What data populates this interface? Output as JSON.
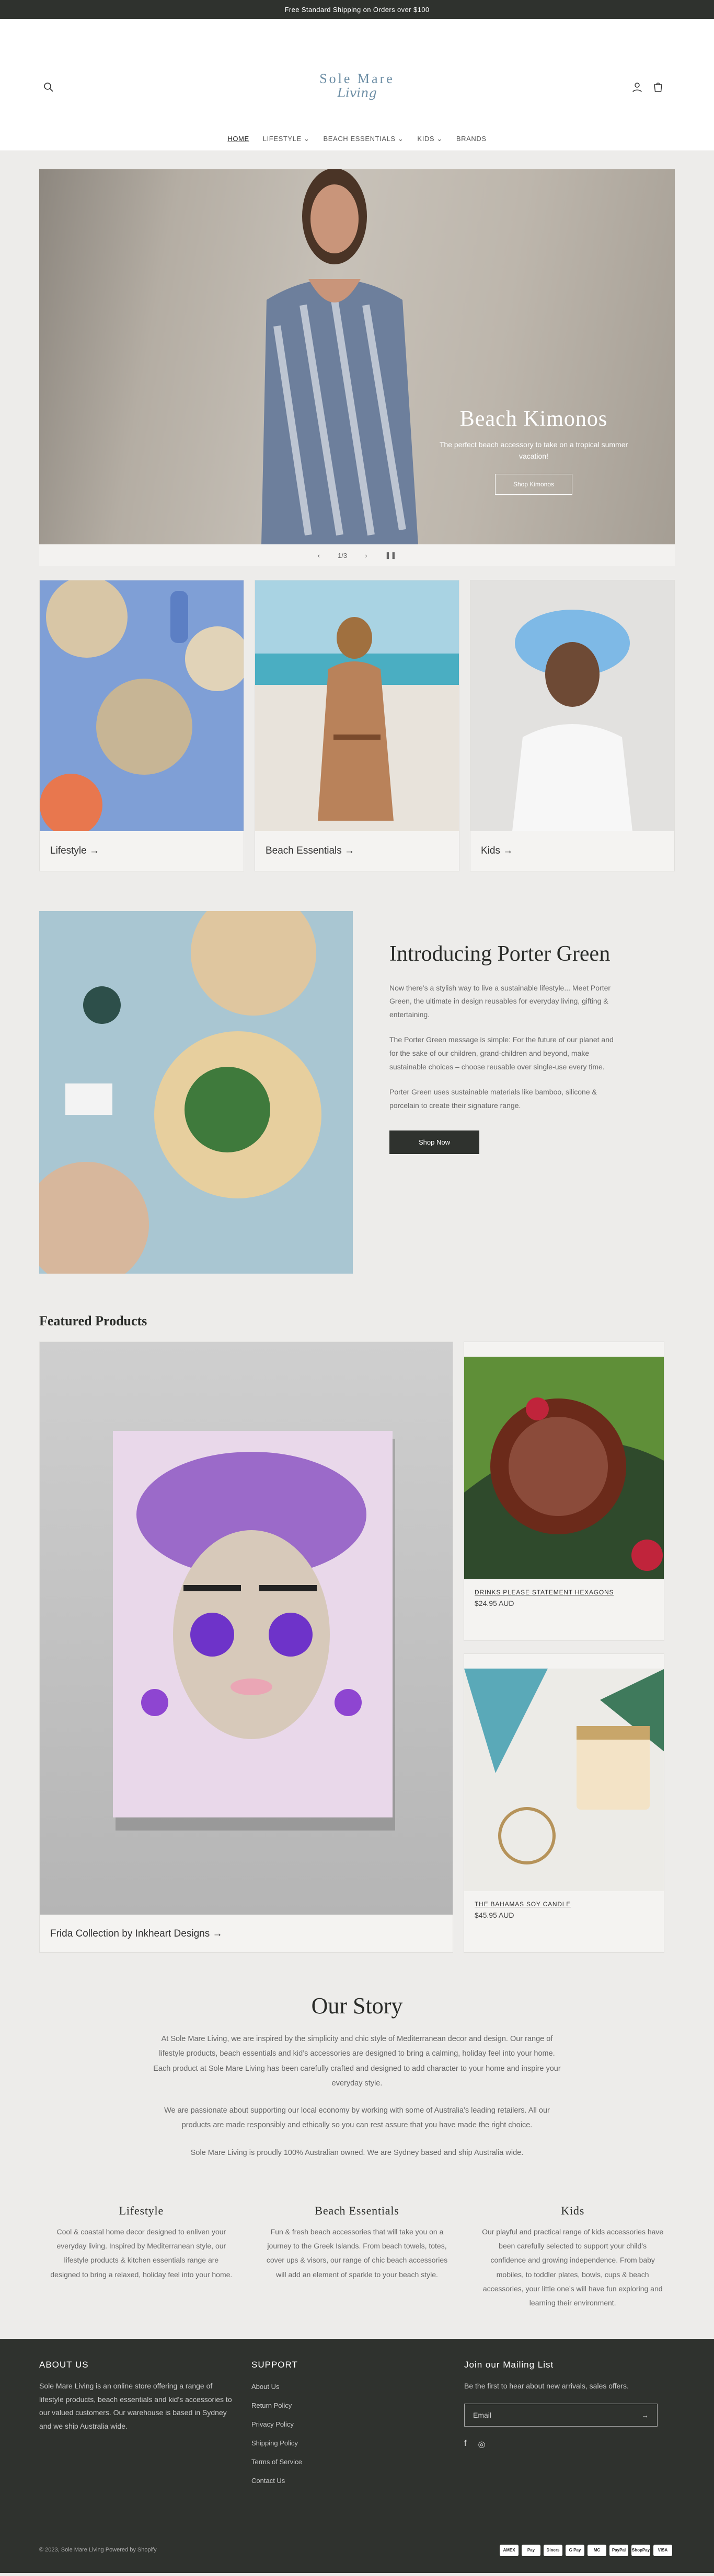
{
  "announcement": "Free Standard Shipping on Orders over $100",
  "logo": {
    "line1": "Sole Mare",
    "line2": "Living"
  },
  "nav": [
    "HOME",
    "LIFESTYLE",
    "BEACH ESSENTIALS",
    "KIDS",
    "BRANDS"
  ],
  "hero": {
    "title": "Beach Kimonos",
    "subtitle": "The perfect beach accessory to take on a tropical summer vacation!",
    "button": "Shop Kimonos",
    "slide_counter": "1/3"
  },
  "collections": [
    {
      "label": "Lifestyle →"
    },
    {
      "label": "Beach Essentials →"
    },
    {
      "label": "Kids →"
    }
  ],
  "intro": {
    "heading": "Introducing Porter Green",
    "p1": "Now there’s a stylish way to live a sustainable lifestyle... Meet Porter Green, the ultimate in design reusables for everyday living, gifting & entertaining.",
    "p2": "The Porter Green message is simple: For the future of our planet and for the sake of our children, grand-children and beyond, make sustainable choices – choose reusable over single-use every time.",
    "p3": "Porter Green uses sustainable materials like bamboo, silicone & porcelain to create their signature range.",
    "button": "Shop Now"
  },
  "featured": {
    "heading": "Featured Products",
    "big_label": "Frida Collection by Inkheart Designs →",
    "products": [
      {
        "name": "DRINKS PLEASE STATEMENT HEXAGONS",
        "price": "$24.95 AUD"
      },
      {
        "name": "THE BAHAMAS SOY CANDLE",
        "price": "$45.95 AUD"
      }
    ]
  },
  "story": {
    "heading": "Our Story",
    "p1": "At Sole Mare Living, we are inspired by the simplicity and chic style of Mediterranean decor and design. Our range of lifestyle products, beach essentials and kid’s accessories are designed to bring a calming, holiday feel into your home. Each product at Sole Mare Living has been carefully crafted and designed to add character to your home and inspire your everyday style.",
    "p2": "We are passionate about supporting our local economy by working with some of Australia’s leading retailers. All our products are made responsibly and ethically so you can rest assure that you have made the right choice.",
    "p3": "Sole Mare Living is proudly 100% Australian owned. We are Sydney based and ship Australia wide."
  },
  "columns": [
    {
      "title": "Lifestyle",
      "text": "Cool & coastal home decor designed to enliven your everyday living. Inspired by Mediterranean style, our lifestyle products & kitchen essentials range are designed to bring a relaxed, holiday feel into your home."
    },
    {
      "title": "Beach Essentials",
      "text": "Fun & fresh beach accessories that will take you on a journey to the Greek Islands. From beach towels, totes, cover ups & visors, our range of chic beach accessories will add an element of sparkle to your beach style."
    },
    {
      "title": "Kids",
      "text": "Our playful and practical range of kids accessories have been carefully selected to support your child’s confidence and growing independence. From baby mobiles, to toddler plates, bowls, cups & beach accessories, your little one’s will have fun exploring and learning their environment."
    }
  ],
  "footer": {
    "about_title": "ABOUT US",
    "about_text": "Sole Mare Living is an online store offering a range of lifestyle products, beach essentials and kid’s accessories to our valued customers. Our warehouse is based in Sydney and we ship Australia wide.",
    "support_title": "SUPPORT",
    "support_links": [
      "About Us",
      "Return Policy",
      "Privacy Policy",
      "Shipping Policy",
      "Terms of Service",
      "Contact Us"
    ],
    "mail_title": "Join our Mailing List",
    "mail_text": "Be the first to hear about new arrivals, sales offers.",
    "email_placeholder": "Email",
    "copyright": "© 2023, Sole Mare Living Powered by Shopify",
    "payments": [
      "AMEX",
      "Pay",
      "Diners",
      "G Pay",
      "MC",
      "PayPal",
      "ShopPay",
      "VISA"
    ]
  }
}
